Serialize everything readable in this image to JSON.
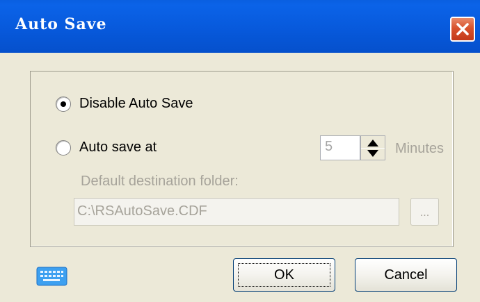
{
  "window": {
    "title": "Auto Save",
    "close_icon": "close-icon"
  },
  "options": {
    "disable_label": "Disable Auto Save",
    "disable_selected": true,
    "autosave_label": "Auto save at",
    "autosave_selected": false,
    "interval_value": "5",
    "interval_unit": "Minutes",
    "destination_label": "Default destination folder:",
    "destination_path": "C:\\RSAutoSave.CDF",
    "browse_label": "..."
  },
  "footer": {
    "keyboard_icon": "keyboard-icon",
    "ok_label": "OK",
    "cancel_label": "Cancel"
  },
  "colors": {
    "titlebar": "#0758DA",
    "close_button": "#D8522C",
    "dialog_bg": "#ECE9D8",
    "disabled_text": "#A6A39A"
  }
}
